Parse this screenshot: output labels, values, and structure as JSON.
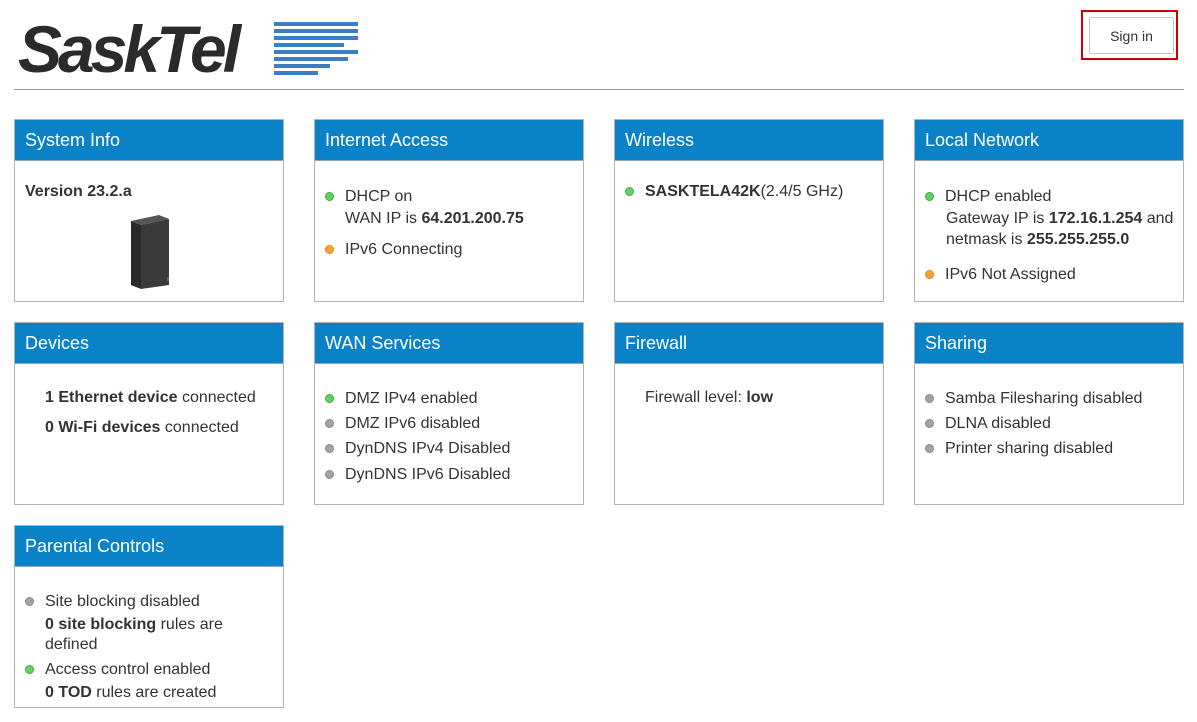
{
  "header": {
    "logo_text": "SaskTel",
    "signin_label": "Sign in",
    "accent": "#0a82c8",
    "highlight_color": "#cc0000"
  },
  "cards": {
    "system_info": {
      "title": "System Info",
      "version": "Version 23.2.a"
    },
    "internet_access": {
      "title": "Internet Access",
      "dhcp": "DHCP on",
      "wan_ip_label": "WAN IP is ",
      "wan_ip": "64.201.200.75",
      "ipv6": "IPv6 Connecting"
    },
    "wireless": {
      "title": "Wireless",
      "ssid": "SASKTELA42K",
      "band": "(2.4/5 GHz)"
    },
    "local_network": {
      "title": "Local Network",
      "dhcp": "DHCP enabled",
      "gateway_label": "Gateway IP is ",
      "gateway_ip": "172.16.1.254",
      "and": " and",
      "netmask_label": "netmask is ",
      "netmask": "255.255.255.0",
      "ipv6": "IPv6 Not Assigned"
    },
    "devices": {
      "title": "Devices",
      "ethernet_count": "1 Ethernet device",
      "ethernet_suffix": " connected",
      "wifi_count": "0 Wi-Fi devices",
      "wifi_suffix": " connected"
    },
    "wan_services": {
      "title": "WAN Services",
      "items": [
        "DMZ IPv4 enabled",
        "DMZ IPv6 disabled",
        "DynDNS IPv4 Disabled",
        "DynDNS IPv6 Disabled"
      ]
    },
    "firewall": {
      "title": "Firewall",
      "label": "Firewall level: ",
      "level": "low"
    },
    "sharing": {
      "title": "Sharing",
      "items": [
        "Samba Filesharing disabled",
        "DLNA disabled",
        "Printer sharing disabled"
      ]
    },
    "parental_controls": {
      "title": "Parental Controls",
      "site_blocking": "Site blocking disabled",
      "site_rules_bold": "0 site blocking",
      "site_rules_suffix": " rules are",
      "site_rules_line2": "defined",
      "access_control": "Access control enabled",
      "tod_bold": "0 TOD",
      "tod_suffix": " rules are created"
    }
  }
}
